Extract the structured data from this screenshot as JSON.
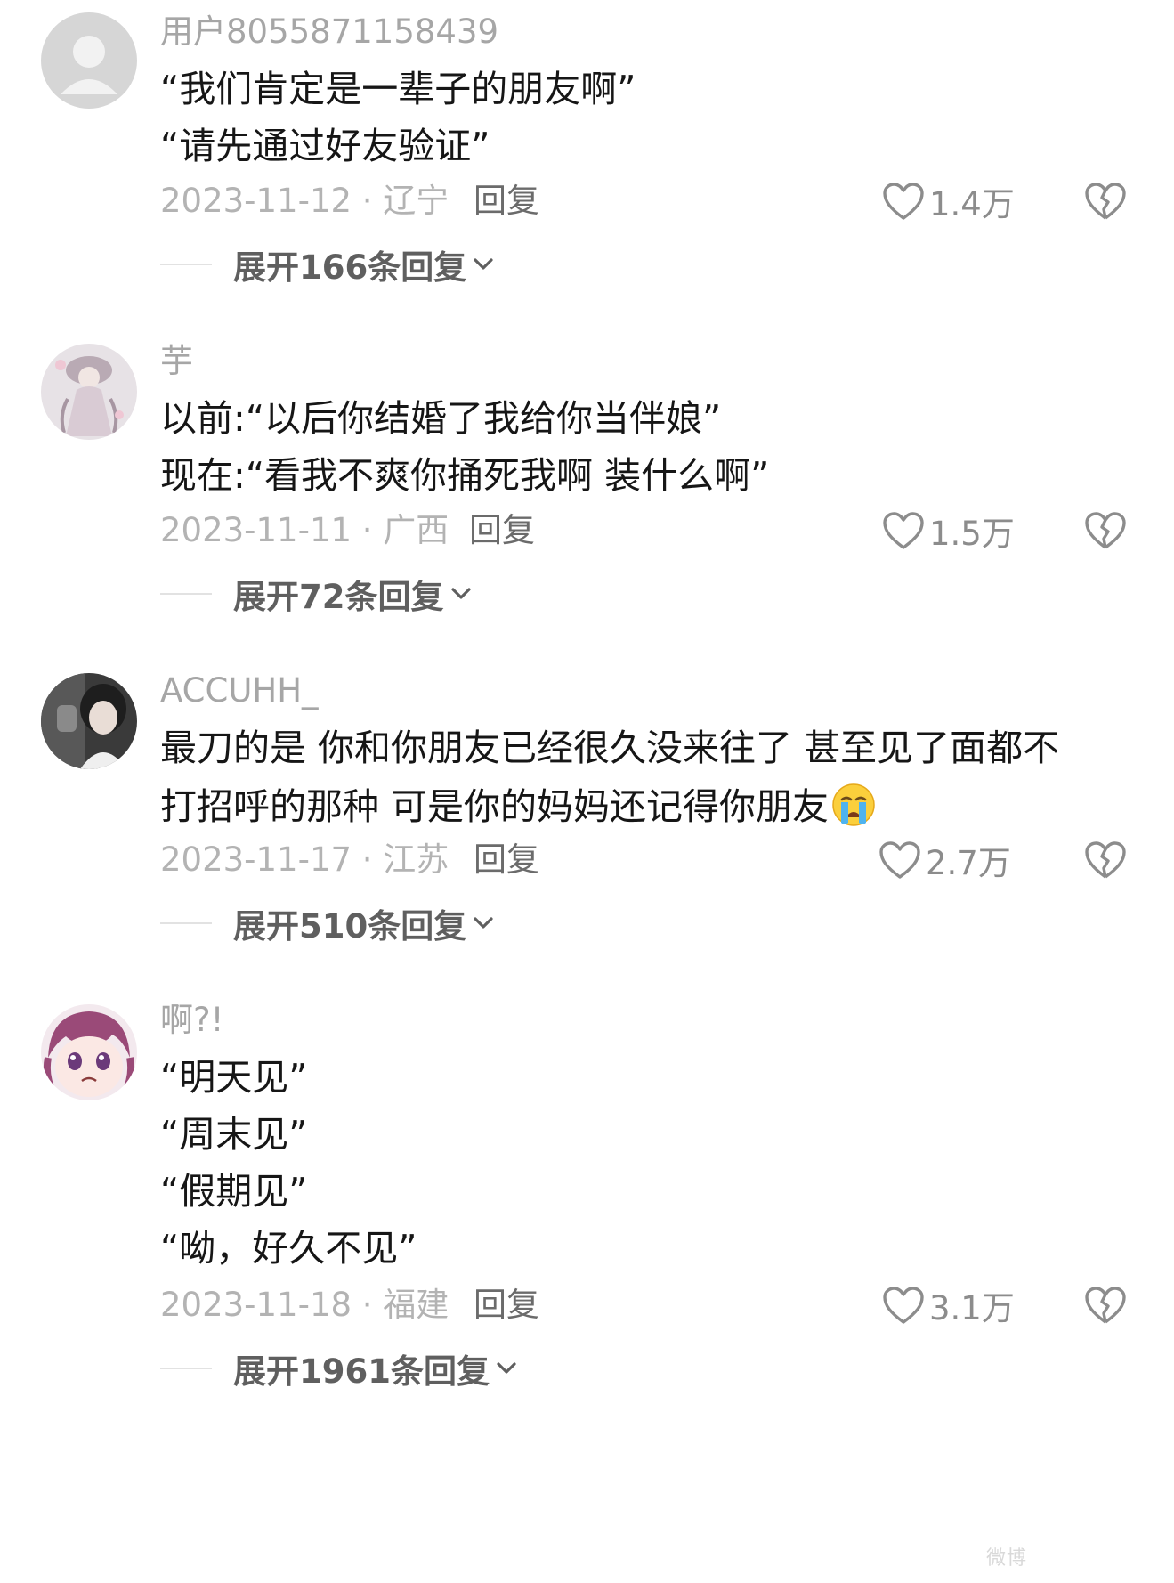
{
  "comments": [
    {
      "username": "用户8055871158439",
      "lines": [
        "“我们肯定是一辈子的朋友啊”",
        "“请先通过好友验证”"
      ],
      "date_location": "2023-11-12 · 辽宁",
      "reply_label": "回复",
      "likes": "1.4万",
      "expand_label": "展开166条回复"
    },
    {
      "username": "芋",
      "lines": [
        "以前:“以后你结婚了我给你当伴娘”",
        "现在:“看我不爽你捅死我啊 装什么啊”"
      ],
      "date_location": "2023-11-11 · 广西",
      "reply_label": "回复",
      "likes": "1.5万",
      "expand_label": "展开72条回复"
    },
    {
      "username": "ACCUHH_",
      "lines": [
        "最刀的是 你和你朋友已经很久没来往了 甚至见了面都不",
        "打招呼的那种 可是你的妈妈还记得你朋友"
      ],
      "date_location": "2023-11-17 · 江苏",
      "reply_label": "回复",
      "likes": "2.7万",
      "expand_label": "展开510条回复"
    },
    {
      "username": "啊?!",
      "lines": [
        "“明天见”",
        "“周末见”",
        "“假期见”",
        "“呦，好久不见”"
      ],
      "date_location": "2023-11-18 · 福建",
      "reply_label": "回复",
      "likes": "3.1万",
      "expand_label": "展开1961条回复"
    }
  ],
  "icons": {
    "like": "heart-outline-icon",
    "dislike": "broken-heart-icon",
    "expand": "chevron-down-icon",
    "emoji": "crying-face-emoji"
  },
  "colors": {
    "username": "#a6a6a6",
    "meta": "#b3b3b3",
    "text": "#161616",
    "expand": "#5f5f5f"
  },
  "watermark": "微博"
}
